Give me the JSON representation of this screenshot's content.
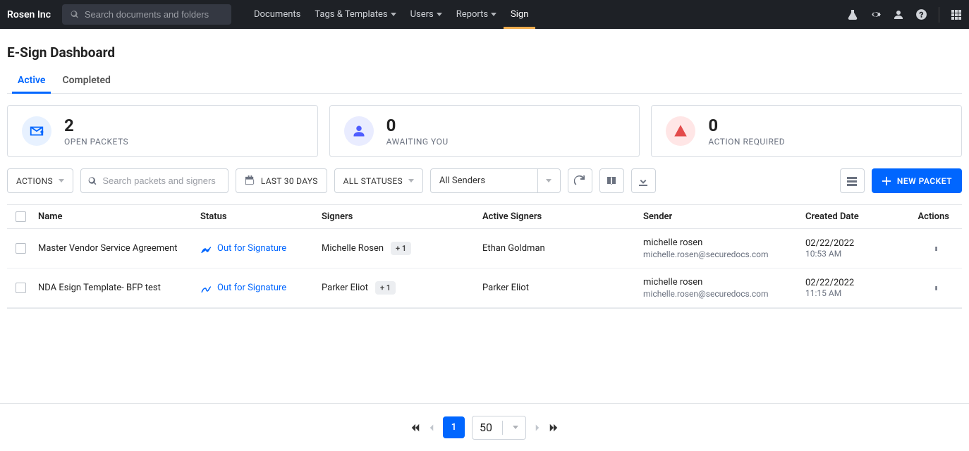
{
  "brand": "Rosen Inc",
  "global_search": {
    "placeholder": "Search documents and folders"
  },
  "nav": {
    "documents": "Documents",
    "tags": "Tags & Templates",
    "users": "Users",
    "reports": "Reports",
    "sign": "Sign"
  },
  "page_title": "E-Sign Dashboard",
  "tabs": {
    "active": "Active",
    "completed": "Completed"
  },
  "cards": {
    "open": {
      "value": "2",
      "label": "OPEN PACKETS"
    },
    "await": {
      "value": "0",
      "label": "AWAITING YOU"
    },
    "action": {
      "value": "0",
      "label": "ACTION REQUIRED"
    }
  },
  "toolbar": {
    "actions_label": "ACTIONS",
    "packet_search_placeholder": "Search packets and signers",
    "date_filter": "LAST 30 DAYS",
    "status_filter": "ALL STATUSES",
    "sender_filter": "All Senders",
    "new_packet": "NEW PACKET"
  },
  "columns": {
    "name": "Name",
    "status": "Status",
    "signers": "Signers",
    "active_signers": "Active Signers",
    "sender": "Sender",
    "created": "Created Date",
    "actions": "Actions"
  },
  "rows": [
    {
      "name": "Master Vendor Service Agreement",
      "status": "Out for Signature",
      "signer": "Michelle Rosen",
      "signer_extra": "+ 1",
      "active_signer": "Ethan Goldman",
      "sender_name": "michelle rosen",
      "sender_email": "michelle.rosen@securedocs.com",
      "date": "02/22/2022",
      "time": "10:53 AM"
    },
    {
      "name": "NDA Esign Template- BFP test",
      "status": "Out for Signature",
      "signer": "Parker Eliot",
      "signer_extra": "+ 1",
      "active_signer": "Parker Eliot",
      "sender_name": "michelle rosen",
      "sender_email": "michelle.rosen@securedocs.com",
      "date": "02/22/2022",
      "time": "11:15 AM"
    }
  ],
  "pagination": {
    "current": "1",
    "page_size": "50"
  }
}
